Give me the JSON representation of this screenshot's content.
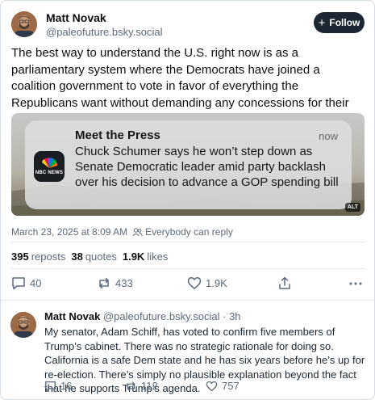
{
  "post": {
    "author_name": "Matt Novak",
    "author_handle": "@paleofuture.bsky.social",
    "follow_label": "Follow",
    "text": "The best way to understand the U.S. right now is as a parliamentary system where the Democrats have joined a coalition government to vote in favor of everything the Republicans want without demanding any concessions for their own constituents.",
    "media": {
      "notification_app": "Meet the Press",
      "notification_time": "now",
      "notification_body": "Chuck Schumer says he won’t step down as Senate Democratic leader amid party backlash over his decision to advance a GOP spending bill",
      "app_icon_label": "NBC NEWS",
      "alt_badge": "ALT"
    },
    "timestamp": "March 23, 2025 at 8:09 AM",
    "reply_setting": "Everybody can reply",
    "stats": {
      "reposts_count": "395",
      "reposts_label": "reposts",
      "quotes_count": "38",
      "quotes_label": "quotes",
      "likes_count": "1.9K",
      "likes_label": "likes"
    },
    "actions": {
      "replies": "40",
      "reposts": "433",
      "likes": "1.9K"
    }
  },
  "reply": {
    "author_name": "Matt Novak",
    "author_handle": "@paleofuture.bsky.social",
    "separator": "·",
    "age": "3h",
    "text": "My senator, Adam Schiff, has voted to confirm five members of Trump’s cabinet. There was no strategic rationale for doing so. California is a safe Dem state and he has six years before he’s up for re-election. There’s simply no plausible explanation beyond the fact that he supports Trump’s agenda.",
    "actions": {
      "replies": "16",
      "reposts": "112",
      "likes": "757"
    }
  },
  "colors": {
    "muted": "#5b6a7a",
    "follow_bg": "#1c2733",
    "divider": "#e4e8ec"
  }
}
